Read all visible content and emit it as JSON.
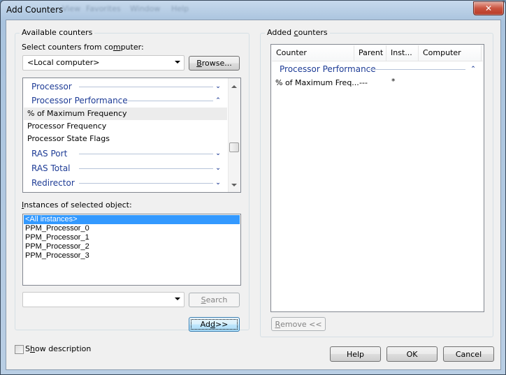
{
  "window": {
    "title": "Add Counters",
    "close_glyph": "✕",
    "background_menu_ghost": [
      "View",
      "Favorites",
      "Window",
      "Help"
    ]
  },
  "available": {
    "group_label": "Available counters",
    "computer_label_pre": "Select counters from co",
    "computer_label_accel": "m",
    "computer_label_post": "puter:",
    "computer_value": "<Local computer>",
    "browse_accel": "B",
    "browse_rest": "rowse...",
    "counters": [
      {
        "type": "category",
        "label": "Processor",
        "expanded": false
      },
      {
        "type": "category",
        "label": "Processor Performance",
        "expanded": true
      },
      {
        "type": "counter",
        "label": "% of Maximum Frequency",
        "selected": true
      },
      {
        "type": "counter",
        "label": "Processor Frequency",
        "selected": false
      },
      {
        "type": "counter",
        "label": "Processor State Flags",
        "selected": false
      },
      {
        "type": "category",
        "label": "RAS Port",
        "expanded": false
      },
      {
        "type": "category",
        "label": "RAS Total",
        "expanded": false
      },
      {
        "type": "category",
        "label": "Redirector",
        "expanded": false
      }
    ],
    "instances_label_accel": "I",
    "instances_label_rest": "nstances of selected object:",
    "instances": [
      {
        "label": "<All instances>",
        "selected": true
      },
      {
        "label": "PPM_Processor_0",
        "selected": false
      },
      {
        "label": "PPM_Processor_1",
        "selected": false
      },
      {
        "label": "PPM_Processor_2",
        "selected": false
      },
      {
        "label": "PPM_Processor_3",
        "selected": false
      }
    ],
    "search_value": "",
    "search_accel": "S",
    "search_rest": "earch",
    "add_pre": "Ad",
    "add_accel": "d",
    "add_post": " >>"
  },
  "added": {
    "group_label_pre": "Added ",
    "group_label_accel": "c",
    "group_label_post": "ounters",
    "columns": [
      "Counter",
      "Parent",
      "Inst...",
      "Computer"
    ],
    "group_header": "Processor Performance",
    "rows": [
      {
        "counter": "% of Maximum Freq...",
        "parent": "---",
        "instance": "*",
        "computer": ""
      }
    ],
    "remove_accel": "R",
    "remove_rest": "emove <<"
  },
  "footer": {
    "show_description_pre": "S",
    "show_description_accel": "h",
    "show_description_post": "ow description",
    "show_description_checked": false,
    "help": "Help",
    "ok": "OK",
    "cancel": "Cancel"
  }
}
